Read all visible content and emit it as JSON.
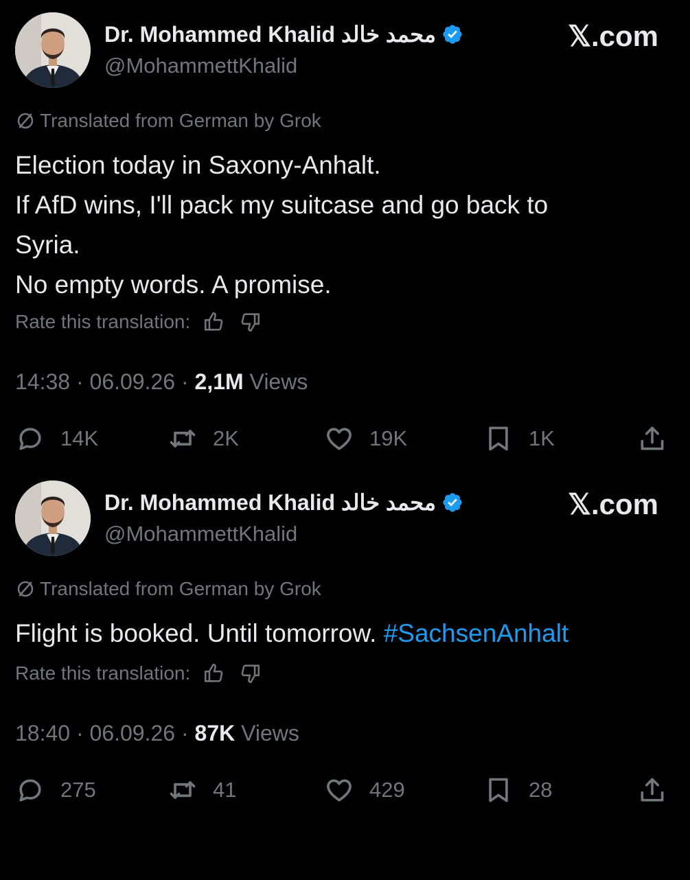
{
  "brand_mark": "𝕏.com",
  "tweets": [
    {
      "author": {
        "name": "Dr. Mohammed Khalid محمد خالد",
        "handle": "@MohammettKhalid",
        "verified": true
      },
      "translation_note": "Translated from German by Grok",
      "body_lines": [
        "Election today in Saxony-Anhalt.",
        "If AfD wins, I'll pack my suitcase and go back to",
        "Syria.",
        "No empty words. A promise."
      ],
      "body_text": "",
      "hashtag": "",
      "rate_label": "Rate this translation:",
      "time": "14:38",
      "date": "06.09.26",
      "views_count": "2,1M",
      "views_label": "Views",
      "stats": {
        "replies": "14K",
        "reposts": "2K",
        "likes": "19K",
        "bookmarks": "1K"
      }
    },
    {
      "author": {
        "name": "Dr. Mohammed Khalid محمد خالد",
        "handle": "@MohammettKhalid",
        "verified": true
      },
      "translation_note": "Translated from German by Grok",
      "body_lines": [],
      "body_text": "Flight is booked. Until tomorrow. ",
      "hashtag": "#SachsenAnhalt",
      "rate_label": "Rate this translation:",
      "time": "18:40",
      "date": "06.09.26",
      "views_count": "87K",
      "views_label": "Views",
      "stats": {
        "replies": "275",
        "reposts": "41",
        "likes": "429",
        "bookmarks": "28"
      }
    }
  ],
  "colors": {
    "background": "#000000",
    "text": "#e7e9ea",
    "secondary": "#71767b",
    "link": "#1d9bf0",
    "verified": "#1d9bf0"
  },
  "icons": [
    "verified-badge-icon",
    "globe-slash-icon",
    "thumbs-up-icon",
    "thumbs-down-icon",
    "reply-icon",
    "repost-icon",
    "like-icon",
    "bookmark-icon",
    "share-icon"
  ]
}
